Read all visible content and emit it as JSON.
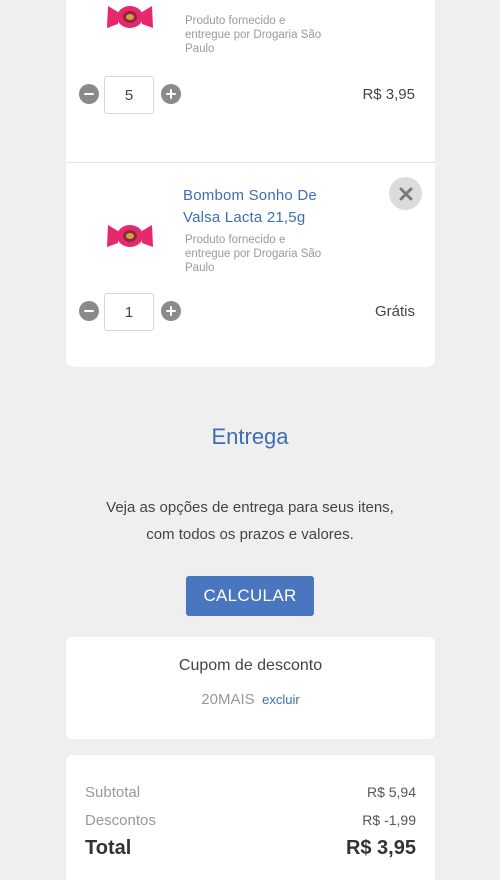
{
  "cart": {
    "items": [
      {
        "seller": "Produto fornecido e entregue por Drogaria São Paulo",
        "quantity": "5",
        "price": "R$ 3,95"
      },
      {
        "name": "Bombom Sonho De Valsa Lacta 21,5g",
        "seller": "Produto fornecido e entregue por Drogaria São Paulo",
        "quantity": "1",
        "price": "Grátis"
      }
    ]
  },
  "delivery": {
    "title": "Entrega",
    "description_line1": "Veja as opções de entrega para seus itens,",
    "description_line2": "com todos os prazos e valores.",
    "calculate_label": "CALCULAR"
  },
  "coupon": {
    "title": "Cupom de desconto",
    "code": "20MAIS",
    "remove_label": "excluir"
  },
  "summary": {
    "subtotal_label": "Subtotal",
    "subtotal_value": "R$ 5,94",
    "discount_label": "Descontos",
    "discount_value": "R$ -1,99",
    "total_label": "Total",
    "total_value": "R$ 3,95"
  },
  "colors": {
    "accent": "#3e6eb4",
    "button": "#4a76c0",
    "candy_pink": "#e8286e",
    "background": "#efefef"
  },
  "icons": {
    "decrease": "minus-circle-icon",
    "increase": "plus-circle-icon",
    "remove": "close-icon"
  }
}
